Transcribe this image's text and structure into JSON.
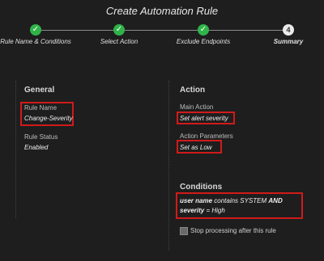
{
  "header": {
    "title": "Create Automation Rule"
  },
  "stepper": {
    "steps": [
      {
        "label": "Rule Name & Conditions",
        "marker": "✓"
      },
      {
        "label": "Select Action",
        "marker": "✓"
      },
      {
        "label": "Exclude Endpoints",
        "marker": "✓"
      },
      {
        "label": "Summary",
        "marker": "4"
      }
    ]
  },
  "general": {
    "heading": "General",
    "rule_name_label": "Rule Name",
    "rule_name_value": "Change-Severity",
    "rule_status_label": "Rule Status",
    "rule_status_value": "Enabled"
  },
  "action": {
    "heading": "Action",
    "main_action_label": "Main Action",
    "main_action_value": "Set alert severity",
    "params_label": "Action Parameters",
    "params_value": "Set as Low"
  },
  "conditions": {
    "heading": "Conditions",
    "part1": "user name",
    "part2": " contains SYSTEM ",
    "part3": "AND severity",
    "part4": " = High",
    "stop_label": "Stop processing after this rule"
  },
  "colors": {
    "accent_green": "#2fb34a",
    "highlight_red": "#d11a1a"
  }
}
